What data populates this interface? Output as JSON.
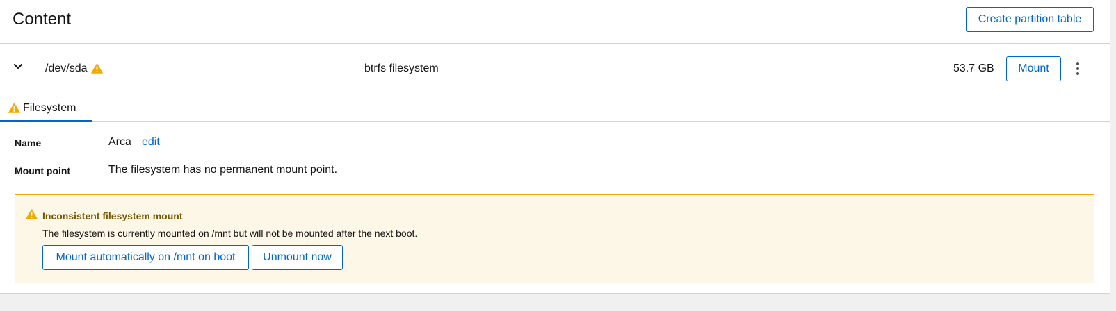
{
  "header": {
    "title": "Content",
    "create_partition_label": "Create partition table"
  },
  "device": {
    "name": "/dev/sda",
    "type": "btrfs filesystem",
    "size": "53.7 GB",
    "mount_label": "Mount",
    "expanded": true,
    "warning": true
  },
  "tabs": [
    {
      "label": "Filesystem",
      "active": true,
      "warning": true
    }
  ],
  "fields": {
    "name_label": "Name",
    "name_value": "Arca",
    "edit_label": "edit",
    "mount_point_label": "Mount point",
    "mount_point_value": "The filesystem has no permanent mount point."
  },
  "alert": {
    "title": "Inconsistent filesystem mount",
    "description": "The filesystem is currently mounted on /mnt but will not be mounted after the next boot.",
    "actions": [
      {
        "label": "Mount automatically on /mnt on boot"
      },
      {
        "label": "Unmount now"
      }
    ]
  },
  "colors": {
    "accent": "#0066cc",
    "warning": "#f0ab00",
    "warning_bg": "#fdf7e7",
    "warning_title": "#795600",
    "border": "#d2d2d2",
    "page_bg": "#f0f0f0"
  },
  "icons": {
    "expand": "chevron-down-icon",
    "warning": "warning-triangle-icon",
    "actions": "kebab-icon"
  }
}
